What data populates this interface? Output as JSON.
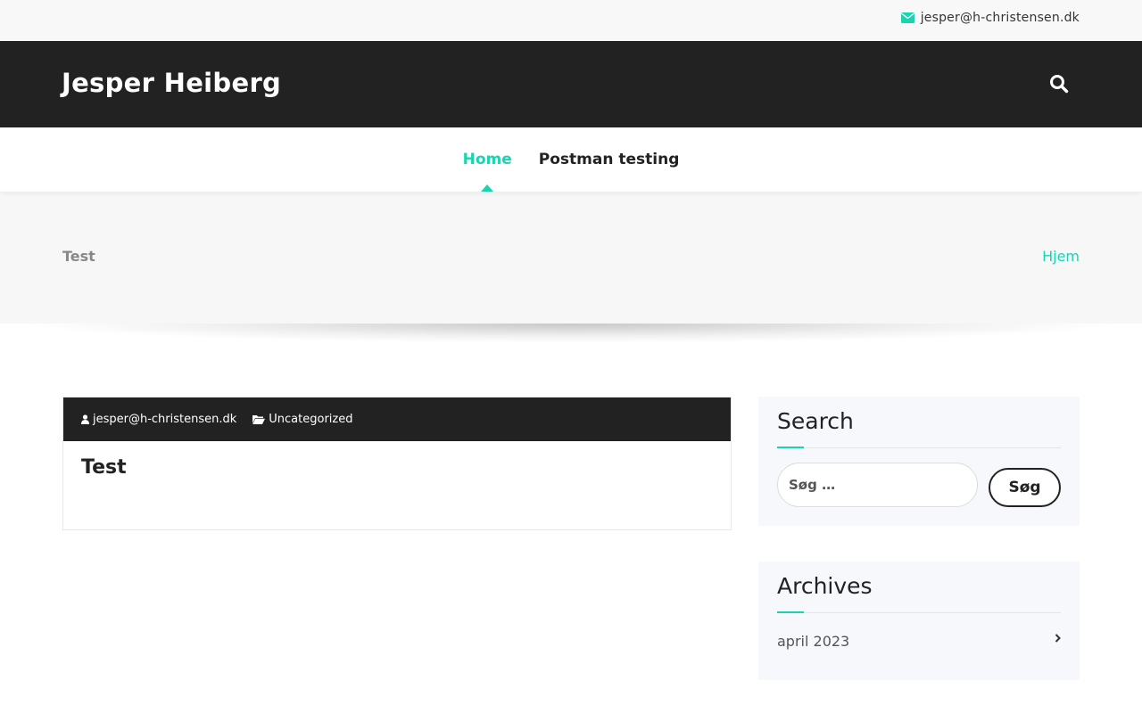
{
  "topbar": {
    "email": "jesper@h-christensen.dk"
  },
  "header": {
    "site_title": "Jesper Heiberg"
  },
  "nav": {
    "items": [
      {
        "label": "Home"
      },
      {
        "label": "Postman testing"
      }
    ]
  },
  "page_header": {
    "title": "Test",
    "breadcrumb": "Hjem"
  },
  "post": {
    "author": "jesper@h-christensen.dk",
    "category": "Uncategorized",
    "title": "Test"
  },
  "sidebar": {
    "search": {
      "title": "Search",
      "placeholder": "Søg …",
      "button": "Søg"
    },
    "archives": {
      "title": "Archives",
      "items": [
        {
          "label": "april 2023"
        }
      ]
    }
  },
  "colors": {
    "accent": "#1ad4b0",
    "dark": "#222222"
  }
}
